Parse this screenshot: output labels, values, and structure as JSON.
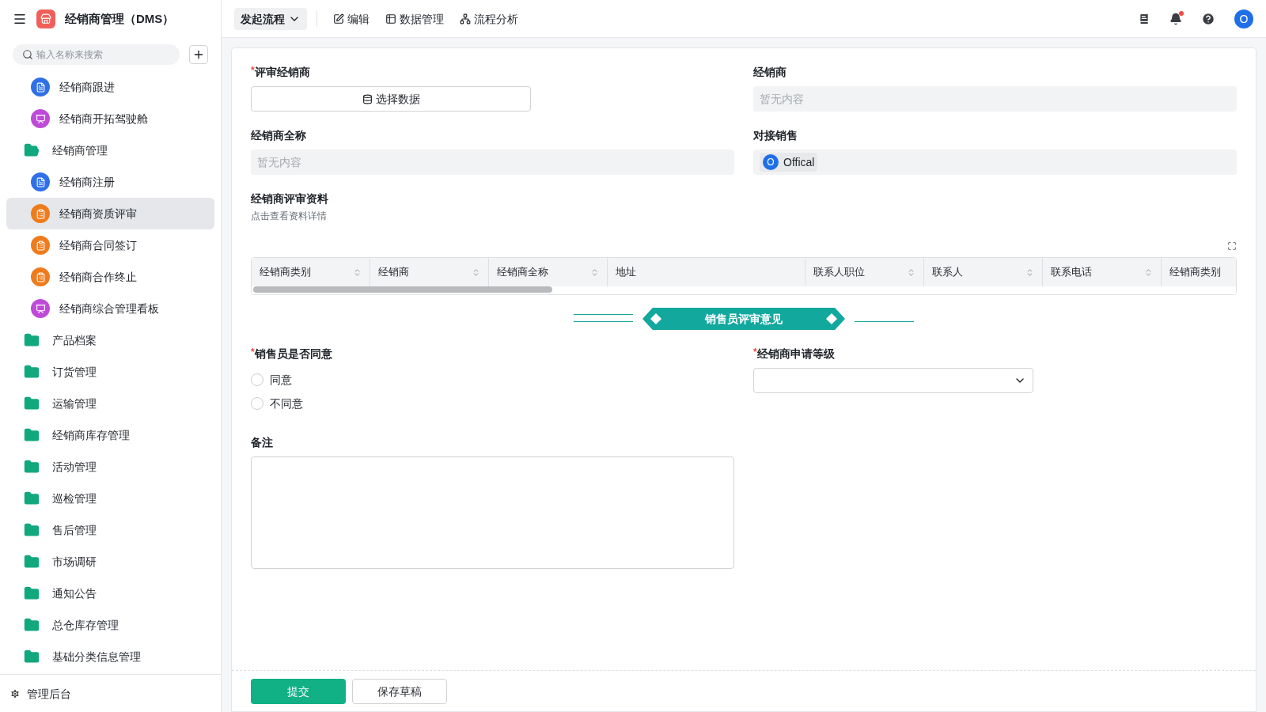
{
  "app": {
    "title": "经销商管理（DMS）"
  },
  "sidebar": {
    "search": {
      "placeholder": "输入名称来搜索"
    },
    "items": [
      {
        "kind": "page",
        "label": "经销商跟进",
        "color": "#2f6fe8",
        "selected": false
      },
      {
        "kind": "page",
        "label": "经销商开拓驾驶舱",
        "color": "#c04ad8",
        "selected": false
      },
      {
        "kind": "folder",
        "label": "经销商管理",
        "expanded": true,
        "children": [
          {
            "kind": "page",
            "label": "经销商注册",
            "color": "#2f6fe8",
            "selected": false
          },
          {
            "kind": "page",
            "label": "经销商资质评审",
            "color": "#f07b1d",
            "selected": true
          },
          {
            "kind": "page",
            "label": "经销商合同签订",
            "color": "#f07b1d",
            "selected": false
          },
          {
            "kind": "page",
            "label": "经销商合作终止",
            "color": "#f07b1d",
            "selected": false
          },
          {
            "kind": "page",
            "label": "经销商综合管理看板",
            "color": "#c04ad8",
            "selected": false
          }
        ]
      },
      {
        "kind": "folder",
        "label": "产品档案",
        "expanded": false
      },
      {
        "kind": "folder",
        "label": "订货管理",
        "expanded": false
      },
      {
        "kind": "folder",
        "label": "运输管理",
        "expanded": false
      },
      {
        "kind": "folder",
        "label": "经销商库存管理",
        "expanded": false
      },
      {
        "kind": "folder",
        "label": "活动管理",
        "expanded": false
      },
      {
        "kind": "folder",
        "label": "巡检管理",
        "expanded": false
      },
      {
        "kind": "folder",
        "label": "售后管理",
        "expanded": false
      },
      {
        "kind": "folder",
        "label": "市场调研",
        "expanded": false
      },
      {
        "kind": "folder",
        "label": "通知公告",
        "expanded": false
      },
      {
        "kind": "folder",
        "label": "总仓库存管理",
        "expanded": false
      },
      {
        "kind": "folder",
        "label": "基础分类信息管理",
        "expanded": false
      }
    ],
    "footer": "管理后台"
  },
  "toolbar": {
    "start": "发起流程",
    "actions": [
      {
        "kind": "edit",
        "label": "编辑"
      },
      {
        "kind": "data",
        "label": "数据管理"
      },
      {
        "kind": "flow",
        "label": "流程分析"
      }
    ],
    "avatar": "O",
    "notification": true
  },
  "form": {
    "review_dealer": {
      "label": "评审经销商",
      "required_mark": "*",
      "button": "选择数据"
    },
    "dealer": {
      "label": "经销商",
      "placeholder": "暂无内容"
    },
    "dealer_full_name": {
      "label": "经销商全称",
      "placeholder": "暂无内容"
    },
    "sales_contact": {
      "label": "对接销售",
      "avatar": "O",
      "name": "Offical"
    },
    "materials": {
      "label": "经销商评审资料",
      "hint": "点击查看资料详情",
      "columns": [
        {
          "label": "经销商类别",
          "sortable": true
        },
        {
          "label": "经销商",
          "sortable": true
        },
        {
          "label": "经销商全称",
          "sortable": true
        },
        {
          "label": "地址",
          "sortable": false
        },
        {
          "label": "联系人职位",
          "sortable": true
        },
        {
          "label": "联系人",
          "sortable": true
        },
        {
          "label": "联系电话",
          "sortable": true
        },
        {
          "label": "经销商类别"
        }
      ]
    },
    "section_title": "销售员评审意见",
    "agree": {
      "label": "销售员是否同意",
      "required_mark": "*",
      "options": [
        {
          "label": "同意",
          "selected": false
        },
        {
          "label": "不同意",
          "selected": false
        }
      ]
    },
    "level": {
      "label": "经销商申请等级",
      "required_mark": "*"
    },
    "remark": {
      "label": "备注"
    },
    "buttons": [
      {
        "kind": "primary",
        "label": "提交"
      },
      {
        "kind": "secondary",
        "label": "保存草稿"
      }
    ]
  }
}
